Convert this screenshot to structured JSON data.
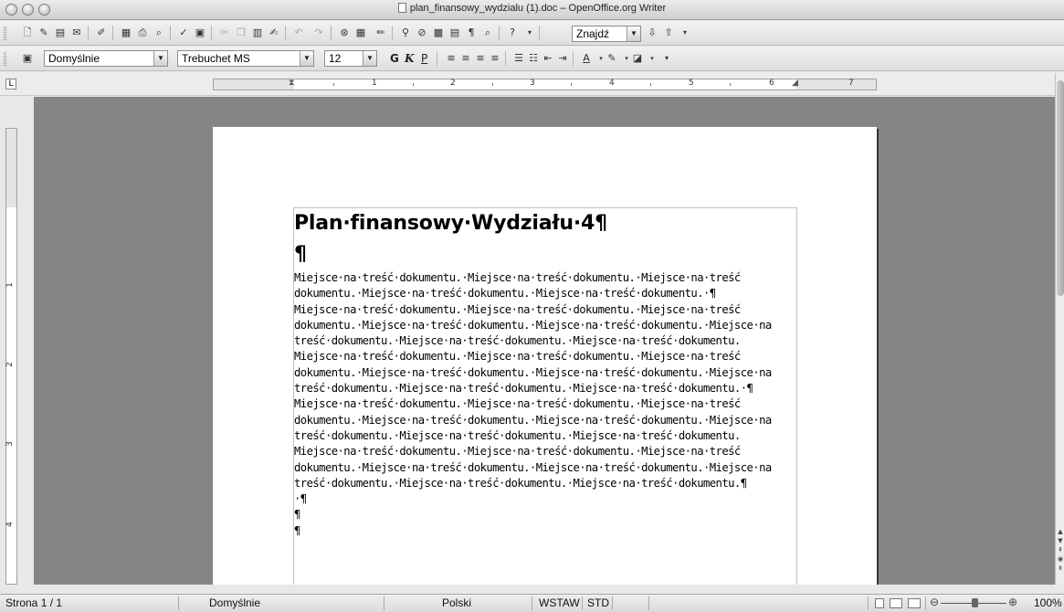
{
  "window": {
    "title": "plan_finansowy_wydzialu (1).doc – OpenOffice.org Writer"
  },
  "toolbar_standard": {
    "find_combo": {
      "value": "Znajdź"
    },
    "icons": [
      "new-icon",
      "edit-file-icon",
      "save-icon",
      "email-icon",
      "edit-mode-icon",
      "export-pdf-icon",
      "print-icon",
      "print-preview-icon",
      "spellcheck-icon",
      "autospellcheck-icon",
      "cut-icon",
      "copy-icon",
      "paste-icon",
      "format-paintbrush-icon",
      "undo-icon",
      "redo-icon",
      "hyperlink-icon",
      "table-icon",
      "draw-icon",
      "find-replace-icon",
      "navigator-icon",
      "gallery-icon",
      "data-sources-icon",
      "nonprinting-chars-icon",
      "zoom-icon",
      "help-icon",
      "find-down-icon",
      "find-up-icon"
    ]
  },
  "toolbar_format": {
    "paragraph_style": {
      "value": "Domyślnie"
    },
    "font_name": {
      "value": "Trebuchet MS"
    },
    "font_size": {
      "value": "12"
    },
    "bold_label": "G",
    "italic_label": "K",
    "underline_label": "P"
  },
  "ruler": {
    "tab_selector": "L",
    "h_numbers": [
      "1",
      "2",
      "3",
      "4",
      "5",
      "6",
      "7"
    ],
    "v_numbers": [
      "1",
      "2",
      "3",
      "4"
    ]
  },
  "document": {
    "title": "Plan·finansowy·Wydziału·4¶",
    "empty_paragraph": "¶",
    "body_lines": [
      "Miejsce·na·treść·dokumentu.·Miejsce·na·treść·dokumentu.·Miejsce·na·treść",
      "dokumentu.·Miejsce·na·treść·dokumentu.·Miejsce·na·treść·dokumentu.·¶",
      "Miejsce·na·treść·dokumentu.·Miejsce·na·treść·dokumentu.·Miejsce·na·treść",
      "dokumentu.·Miejsce·na·treść·dokumentu.·Miejsce·na·treść·dokumentu.·Miejsce·na",
      "treść·dokumentu.·Miejsce·na·treść·dokumentu.·Miejsce·na·treść·dokumentu.",
      "Miejsce·na·treść·dokumentu.·Miejsce·na·treść·dokumentu.·Miejsce·na·treść",
      "dokumentu.·Miejsce·na·treść·dokumentu.·Miejsce·na·treść·dokumentu.·Miejsce·na",
      "treść·dokumentu.·Miejsce·na·treść·dokumentu.·Miejsce·na·treść·dokumentu.·¶",
      "Miejsce·na·treść·dokumentu.·Miejsce·na·treść·dokumentu.·Miejsce·na·treść",
      "dokumentu.·Miejsce·na·treść·dokumentu.·Miejsce·na·treść·dokumentu.·Miejsce·na",
      "treść·dokumentu.·Miejsce·na·treść·dokumentu.·Miejsce·na·treść·dokumentu.",
      "Miejsce·na·treść·dokumentu.·Miejsce·na·treść·dokumentu.·Miejsce·na·treść",
      "dokumentu.·Miejsce·na·treść·dokumentu.·Miejsce·na·treść·dokumentu.·Miejsce·na",
      "treść·dokumentu.·Miejsce·na·treść·dokumentu.·Miejsce·na·treść·dokumentu.¶",
      "·¶",
      "¶",
      "¶"
    ]
  },
  "statusbar": {
    "page": "Strona  1 / 1",
    "style": "Domyślnie",
    "language": "Polski",
    "insert_mode": "WSTAW",
    "selection_mode": "STD",
    "zoom": "100%"
  }
}
